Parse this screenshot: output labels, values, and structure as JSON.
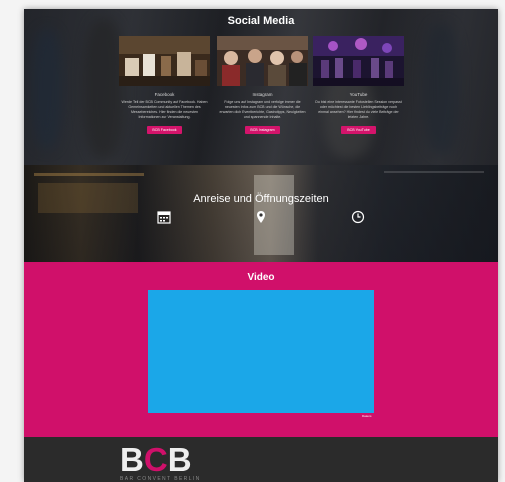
{
  "social": {
    "title": "Social Media",
    "cards": [
      {
        "name": "Facebook",
        "desc": "Werde Teil der BCB Community auf Facebook. Haben Gemeinsamkeiten und aktuellen Themen des Messebereiches. Hier finden die neuesten Informationen zur Veranstaltung.",
        "button": "BCB Facebook"
      },
      {
        "name": "Instagram",
        "desc": "Folge uns auf Instagram und verfolge immer die neuesten Infos zum BCB und die Wünsche, die erwarten dich Eventberichte, Gastrotipps, Neuigkeiten und spannende Inhalte.",
        "button": "BCB Instagram"
      },
      {
        "name": "YouTube",
        "desc": "Du bist eine interessante Fotostellen Session verpasst oder möchtest die besten Lieblingsbeiträge noch einmal ansehen? Hier findest du viele Beiträge der letzten Jahre.",
        "button": "BCB YouTube"
      }
    ]
  },
  "travel": {
    "title": "Anreise und Öffnungszeiten",
    "icons": [
      "calendar-icon",
      "location-pin-icon",
      "clock-icon"
    ]
  },
  "video": {
    "title": "Video",
    "legal": "Datens"
  },
  "footer": {
    "logo_letters": [
      "B",
      "C",
      "B"
    ],
    "logo_subtitle": "BAR CONVENT BERLIN"
  },
  "colors": {
    "accent": "#d0106a",
    "video_player": "#1ba7e8",
    "footer": "#2b2b2b"
  }
}
